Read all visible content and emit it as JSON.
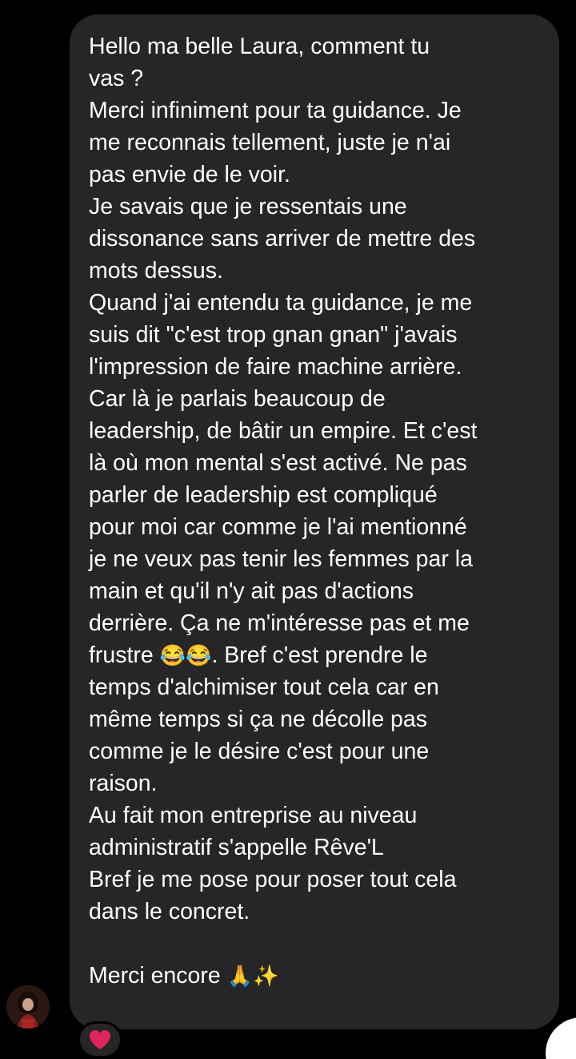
{
  "message": {
    "lines": [
      "Hello ma belle Laura, comment tu",
      "vas ?",
      "Merci infiniment pour ta guidance. Je",
      "me reconnais tellement, juste je n'ai",
      "pas envie de le voir.",
      "Je savais que je ressentais une",
      "dissonance sans arriver de mettre des",
      "mots dessus.",
      "Quand j'ai entendu ta guidance, je me",
      "suis dit \"c'est trop gnan gnan\" j'avais",
      "l'impression de faire machine arrière.",
      "Car là je parlais beaucoup de",
      "leadership, de bâtir un empire. Et c'est",
      "là où mon mental s'est activé. Ne pas",
      "parler de leadership est compliqué",
      "pour moi car comme je l'ai mentionné",
      "je ne veux pas tenir les femmes par la",
      "main et qu'il n'y ait pas d'actions",
      "derrière. Ça ne m'intéresse pas et me",
      "temps d'alchimiser tout cela car en",
      "même temps si ça ne décolle pas",
      "comme je le désire c'est pour une",
      "raison.",
      "Au fait mon entreprise au niveau",
      "administratif s'appelle Rêve'L",
      "Bref je me pose pour poser tout cela",
      "dans le concret."
    ],
    "frustre_line": {
      "before": "frustre ",
      "emoji": "😂😂",
      "after": ". Bref c'est prendre le"
    },
    "closing": {
      "text": "Merci encore ",
      "emoji": "🙏✨"
    }
  },
  "reaction": {
    "emoji": "❤️",
    "icon": "heart-icon",
    "color": "#e0245e"
  },
  "colors": {
    "background": "#000000",
    "bubble": "#262628",
    "text": "#ffffff"
  }
}
